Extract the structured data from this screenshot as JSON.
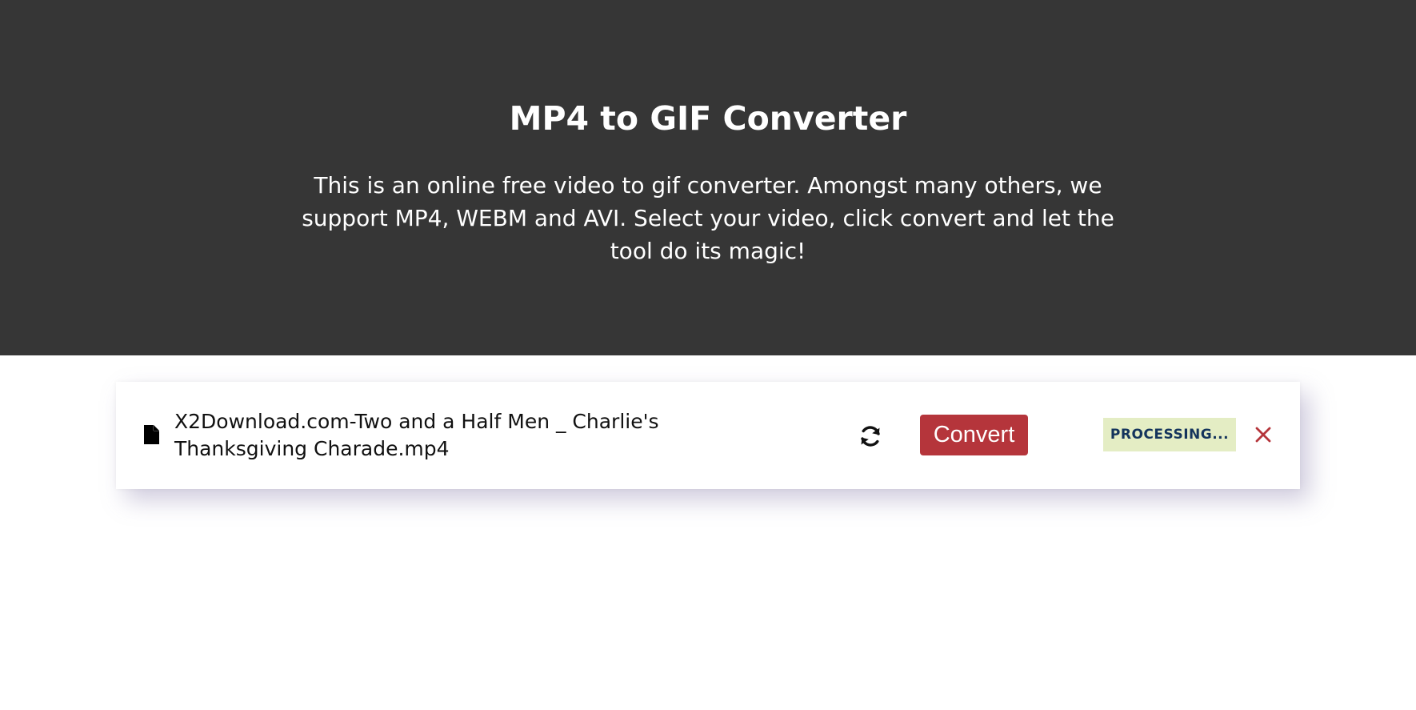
{
  "header": {
    "title": "MP4 to GIF Converter",
    "description": "This is an online free video to gif converter. Amongst many others, we support MP4, WEBM and AVI. Select your video, click convert and let the tool do its magic!"
  },
  "file_item": {
    "icon": "file-icon",
    "file_name": "X2Download.com-Two and a Half Men _ Charlie's Thanksgiving Charade.mp4",
    "refresh_icon": "refresh-icon",
    "convert_label": "Convert",
    "status": "PROCESSING...",
    "close_icon": "close-icon"
  },
  "colors": {
    "hero_background": "#363636",
    "convert_button": "#b5353b",
    "status_badge_background": "#e4edc4",
    "status_badge_text": "#14345c",
    "close_icon": "#b5353b"
  }
}
